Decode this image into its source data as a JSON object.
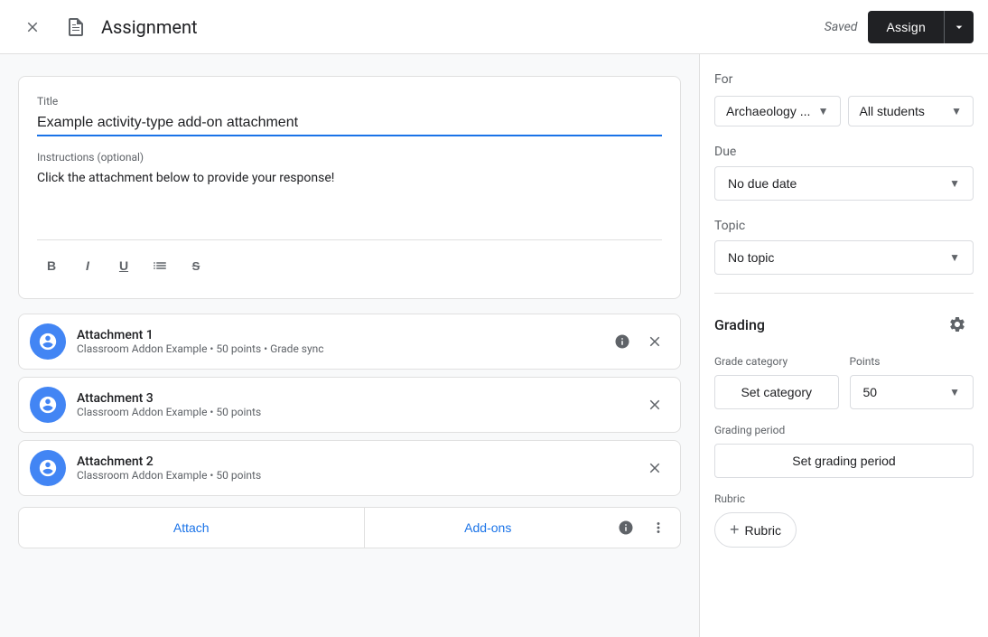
{
  "header": {
    "title": "Assignment",
    "saved_text": "Saved",
    "assign_label": "Assign",
    "close_icon": "×"
  },
  "toolbar": {
    "bold_label": "B",
    "italic_label": "I",
    "underline_label": "U",
    "list_label": "≡",
    "strikethrough_label": "S̶"
  },
  "title_field": {
    "label": "Title",
    "value": "Example activity-type add-on attachment"
  },
  "instructions_field": {
    "label": "Instructions (optional)",
    "value": "Click the attachment below to provide your response!"
  },
  "attachments": [
    {
      "name": "Attachment 1",
      "meta": "Classroom Addon Example • 50 points • Grade sync"
    },
    {
      "name": "Attachment 3",
      "meta": "Classroom Addon Example • 50 points"
    },
    {
      "name": "Attachment 2",
      "meta": "Classroom Addon Example • 50 points"
    }
  ],
  "bottom_bar": {
    "attach_label": "Attach",
    "addons_label": "Add-ons"
  },
  "right_panel": {
    "for_label": "For",
    "class_dropdown": "Archaeology ...",
    "students_dropdown": "All students",
    "due_label": "Due",
    "due_value": "No due date",
    "topic_label": "Topic",
    "topic_value": "No topic",
    "grading_title": "Grading",
    "grade_category_label": "Grade category",
    "points_label": "Points",
    "set_category_label": "Set category",
    "points_value": "50",
    "grading_period_label": "Grading period",
    "set_grading_period_label": "Set grading period",
    "rubric_label": "Rubric",
    "add_rubric_label": "Rubric"
  }
}
